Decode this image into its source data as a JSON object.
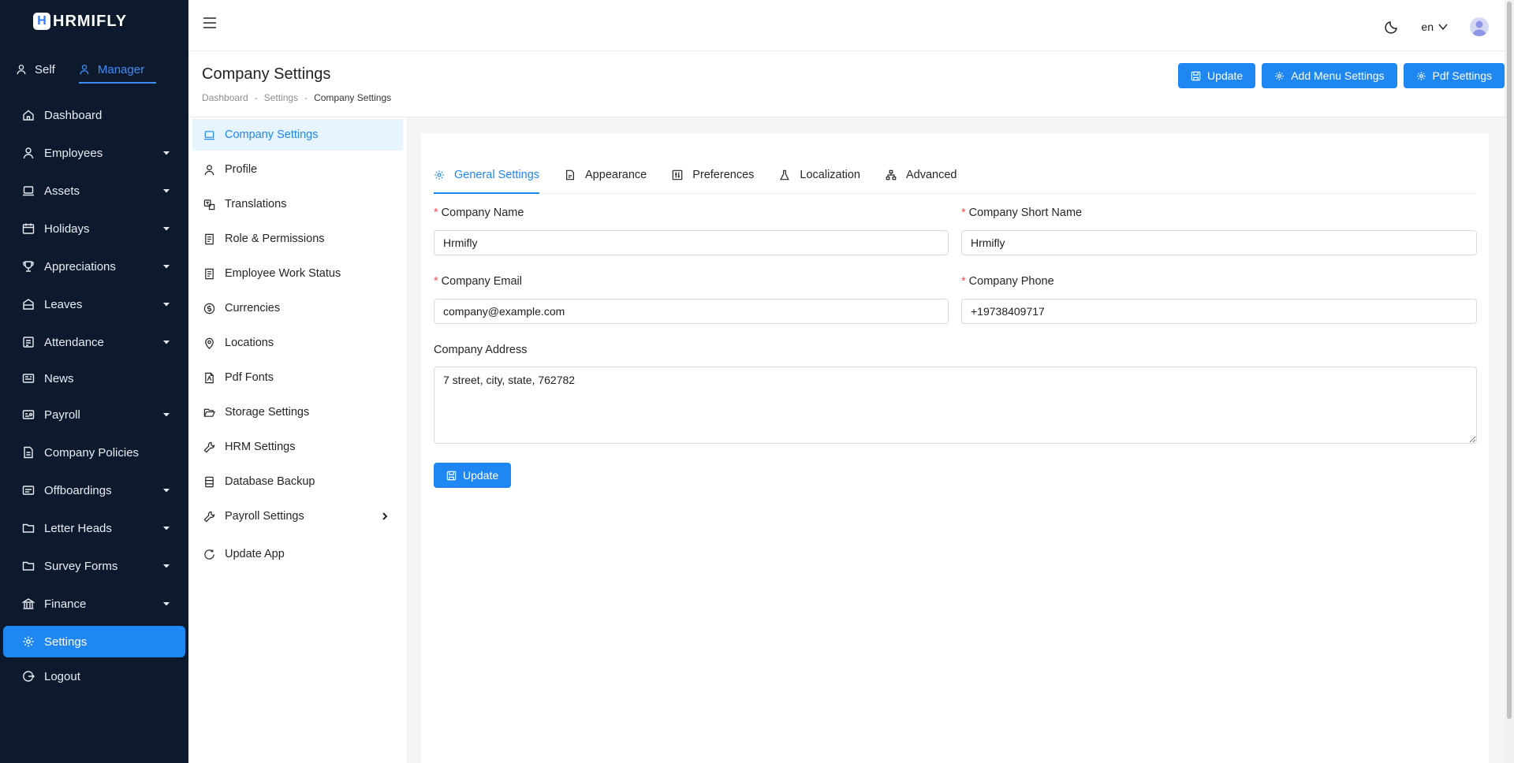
{
  "app": {
    "logo_letter": "H",
    "logo_word": "HRMIFLY"
  },
  "modes": [
    {
      "label": "Self"
    },
    {
      "label": "Manager"
    }
  ],
  "nav": [
    {
      "label": "Dashboard",
      "icon": "home-icon"
    },
    {
      "label": "Employees",
      "icon": "user-icon"
    },
    {
      "label": "Assets",
      "icon": "laptop-icon"
    },
    {
      "label": "Holidays",
      "icon": "calendar-icon"
    },
    {
      "label": "Appreciations",
      "icon": "trophy-icon"
    },
    {
      "label": "Leaves",
      "icon": "leaf-icon"
    },
    {
      "label": "Attendance",
      "icon": "attendance-icon"
    },
    {
      "label": "News",
      "icon": "news-icon"
    },
    {
      "label": "Payroll",
      "icon": "payroll-icon"
    },
    {
      "label": "Company Policies",
      "icon": "policy-icon"
    },
    {
      "label": "Offboardings",
      "icon": "offboarding-icon"
    },
    {
      "label": "Letter Heads",
      "icon": "folder-icon"
    },
    {
      "label": "Survey Forms",
      "icon": "folder-icon"
    },
    {
      "label": "Finance",
      "icon": "bank-icon"
    },
    {
      "label": "Settings",
      "icon": "gear-icon"
    },
    {
      "label": "Logout",
      "icon": "logout-icon"
    }
  ],
  "header": {
    "language": "en"
  },
  "page": {
    "title": "Company Settings",
    "breadcrumb": [
      "Dashboard",
      "Settings",
      "Company Settings"
    ],
    "actions": {
      "update": "Update",
      "add_menu": "Add Menu Settings",
      "pdf": "Pdf Settings"
    }
  },
  "settings_menu": [
    {
      "label": "Company Settings"
    },
    {
      "label": "Profile"
    },
    {
      "label": "Translations"
    },
    {
      "label": "Role & Permissions"
    },
    {
      "label": "Employee Work Status"
    },
    {
      "label": "Currencies"
    },
    {
      "label": "Locations"
    },
    {
      "label": "Pdf Fonts"
    },
    {
      "label": "Storage Settings"
    },
    {
      "label": "HRM Settings"
    },
    {
      "label": "Database Backup"
    },
    {
      "label": "Payroll Settings"
    },
    {
      "label": "Update App"
    }
  ],
  "tabs": [
    {
      "label": "General Settings"
    },
    {
      "label": "Appearance"
    },
    {
      "label": "Preferences"
    },
    {
      "label": "Localization"
    },
    {
      "label": "Advanced"
    }
  ],
  "form": {
    "company_name": {
      "label": "Company Name",
      "value": "Hrmifly"
    },
    "company_short_name": {
      "label": "Company Short Name",
      "value": "Hrmifly"
    },
    "company_email": {
      "label": "Company Email",
      "value": "company@example.com"
    },
    "company_phone": {
      "label": "Company Phone",
      "value": "+19738409717"
    },
    "company_address": {
      "label": "Company Address",
      "value": "7 street, city, state, 762782"
    },
    "required_mark": "*",
    "submit": "Update"
  },
  "colors": {
    "primary": "#1f87f2",
    "sidebar_bg": "#0d1a2d",
    "required": "#ff4d4f"
  }
}
